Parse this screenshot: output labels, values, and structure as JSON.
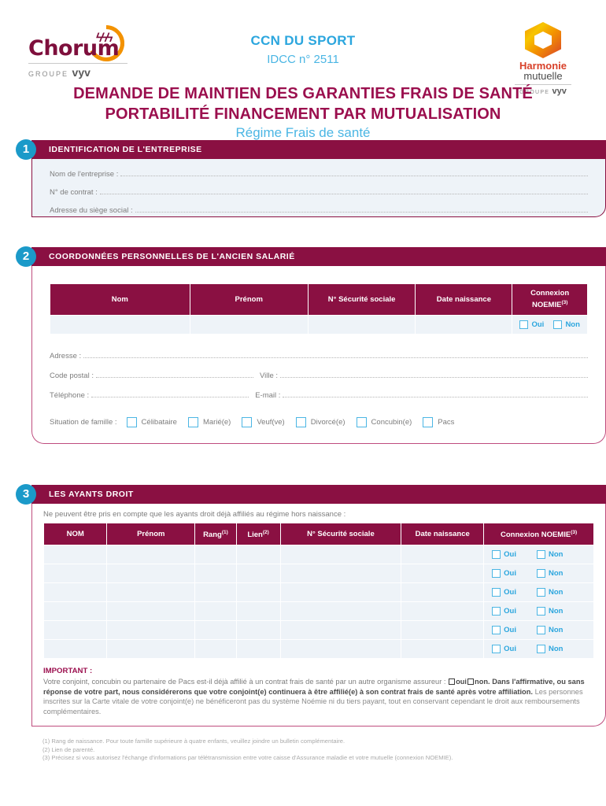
{
  "header": {
    "logo_left": {
      "name": "Chorum",
      "tagline_prefix": "GROUPE",
      "tagline_brand": "vyv"
    },
    "center_title": "CCN DU SPORT",
    "center_subtitle": "IDCC n° 2511",
    "logo_right": {
      "name_line1": "Harmonie",
      "name_line2": "mutuelle",
      "tagline_prefix": "GROUPE",
      "tagline_brand": "vyv"
    },
    "main_title_line1": "DEMANDE DE MAINTIEN DES GARANTIES FRAIS DE SANTÉ",
    "main_title_line2": "PORTABILITÉ FINANCEMENT PAR MUTUALISATION",
    "regime": "Régime Frais de santé"
  },
  "colors": {
    "primary_purple": "#8A1042",
    "title_purple": "#9B0F4E",
    "cyan": "#2BA6DE",
    "badge_blue": "#1B9AC9",
    "panel_bg": "#EEF3F8",
    "border_pink": "#BF4C7E",
    "orange": "#F39200",
    "red_orange": "#D8412A"
  },
  "section1": {
    "number": "1",
    "title": "IDENTIFICATION DE L'ENTREPRISE",
    "fields": [
      {
        "label": "Nom de l'entreprise :",
        "value": ""
      },
      {
        "label": "N° de contrat :",
        "value": ""
      },
      {
        "label": "Adresse du siège social :",
        "value": ""
      }
    ]
  },
  "section2": {
    "number": "2",
    "title": "COORDONNÉES PERSONNELLES DE L'ANCIEN SALARIÉ",
    "table": {
      "headers": [
        {
          "text": "Nom",
          "note": ""
        },
        {
          "text": "Prénom",
          "note": ""
        },
        {
          "text": "N° Sécurité sociale",
          "note": ""
        },
        {
          "text": "Date naissance",
          "note": ""
        },
        {
          "text": "Connexion NOEMIE",
          "note": "(3)"
        }
      ],
      "rows": [
        {
          "nom": "",
          "prenom": "",
          "secu": "",
          "date": "",
          "oui": "Oui",
          "non": "Non"
        }
      ]
    },
    "fields": [
      {
        "label": "Adresse :",
        "value": ""
      }
    ],
    "field_pairs": [
      {
        "label1": "Code postal :",
        "value1": "",
        "label2": "Ville :",
        "value2": ""
      },
      {
        "label1": "Téléphone :",
        "value1": "",
        "label2": "E-mail :",
        "value2": ""
      }
    ],
    "famille_label": "Situation de famille :",
    "famille_options": [
      "Célibataire",
      "Marié(e)",
      "Veuf(ve)",
      "Divorcé(e)",
      "Concubin(e)",
      "Pacs"
    ]
  },
  "section3": {
    "number": "3",
    "title": "LES AYANTS DROIT",
    "intro": "Ne peuvent être pris en compte que les ayants droit déjà affiliés au régime hors naissance :",
    "table": {
      "headers": [
        {
          "text": "NOM",
          "note": ""
        },
        {
          "text": "Prénom",
          "note": ""
        },
        {
          "text": "Rang",
          "note": "(1)"
        },
        {
          "text": "Lien",
          "note": "(2)"
        },
        {
          "text": "N° Sécurité sociale",
          "note": ""
        },
        {
          "text": "Date naissance",
          "note": ""
        },
        {
          "text": "Connexion NOEMIE",
          "note": "(3)"
        }
      ],
      "row_count": 6,
      "oui_label": "Oui",
      "non_label": "Non",
      "rows": [
        {
          "nom": "",
          "prenom": "",
          "rang": "",
          "lien": "",
          "secu": "",
          "date": ""
        },
        {
          "nom": "",
          "prenom": "",
          "rang": "",
          "lien": "",
          "secu": "",
          "date": ""
        },
        {
          "nom": "",
          "prenom": "",
          "rang": "",
          "lien": "",
          "secu": "",
          "date": ""
        },
        {
          "nom": "",
          "prenom": "",
          "rang": "",
          "lien": "",
          "secu": "",
          "date": ""
        },
        {
          "nom": "",
          "prenom": "",
          "rang": "",
          "lien": "",
          "secu": "",
          "date": ""
        },
        {
          "nom": "",
          "prenom": "",
          "rang": "",
          "lien": "",
          "secu": "",
          "date": ""
        }
      ]
    },
    "important": {
      "heading": "IMPORTANT :",
      "line1": "Votre conjoint, concubin ou partenaire de Pacs est-il déjà affilié à un contrat frais de santé par un autre organisme assureur :",
      "oui": "oui",
      "non": "non.",
      "bold_part": "Dans l'affirmative, ou sans réponse de votre part, nous considérerons que votre conjoint(e) continuera à être affilié(e) à son contrat frais de santé après votre affiliation.",
      "tail": "Les personnes inscrites sur la Carte vitale de votre conjoint(e) ne bénéficeront pas du système Noémie ni du tiers payant, tout en conservant cependant le droit aux remboursements complémentaires."
    }
  },
  "footnotes": [
    "(1) Rang de naissance. Pour toute famille supérieure à quatre enfants, veuillez joindre un bulletin complémentaire.",
    "(2) Lien de parenté.",
    "(3) Précisez si vous autorisez l'échange d'informations par télétransmission entre votre caisse d'Assurance maladie et votre mutuelle (connexion NOEMIE)."
  ]
}
